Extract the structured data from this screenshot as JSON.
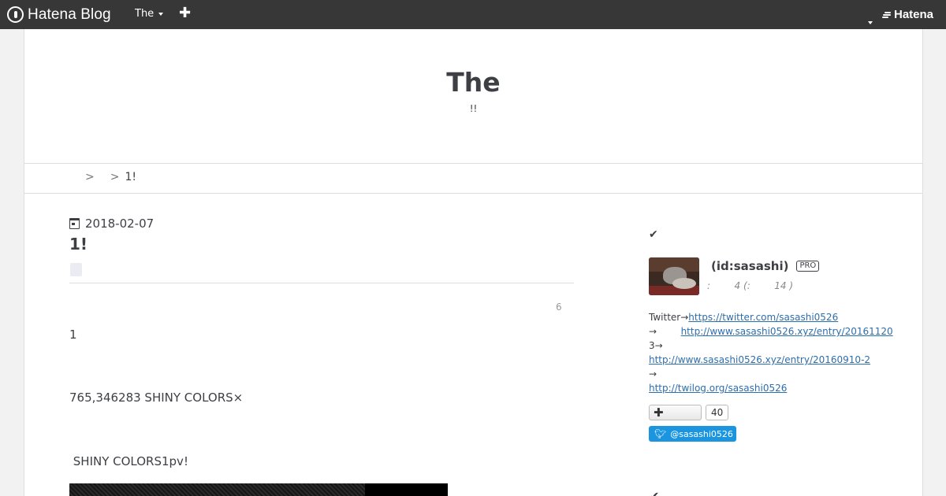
{
  "globalheader": {
    "logo_text": "Hatena Blog",
    "blog_menu_label": "The",
    "add_label": "✚",
    "hatena_label": "Hatena"
  },
  "blog": {
    "title": "The",
    "description": "!!"
  },
  "breadcrumb": {
    "sep1": ">",
    "sep2": ">",
    "current": "1!"
  },
  "entry": {
    "date": "2018-02-07",
    "title": "1!",
    "count": "6",
    "paragraphs": [
      "1",
      "765,346283 SHINY COLORS×",
      " SHINY COLORS1pv!"
    ]
  },
  "sidebar": {
    "check_icon": "✔",
    "profile": {
      "name": "(id:sasashi)",
      "badge": "PRO",
      "stats": ":        4 (:        14 )"
    },
    "desc": {
      "twitter_prefix": "Twitter→",
      "twitter_url": "https://twitter.com/sasashi0526",
      "line2_prefix": "→        ",
      "line2_url": "http://www.sasashi0526.xyz/entry/20161120",
      "line3_prefix": "3→",
      "line3_url": "http://www.sasashi0526.xyz/entry/20160910-2",
      "line4_prefix": "→",
      "line4_url": "http://twilog.org/sasashi0526"
    },
    "follow_count": "40",
    "twitter_button": "@sasashi0526",
    "bottom_heading": "✔"
  },
  "colors": {
    "header_bg": "#373737",
    "link": "#2d6eac",
    "twitter": "#1b95e0"
  }
}
